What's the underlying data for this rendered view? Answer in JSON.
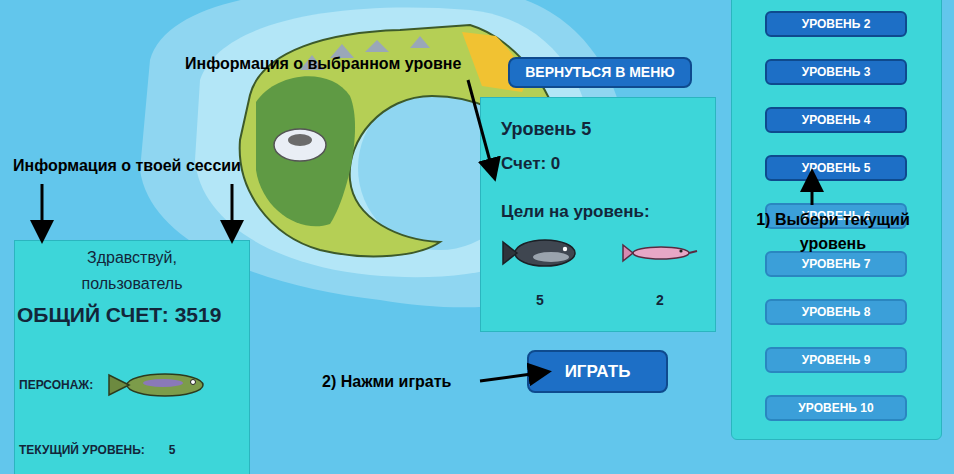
{
  "annotations": {
    "level_info": "Информация о выбранном уровне",
    "session_info": "Информация о твоей сессии",
    "choose_level": "1) Выбери текущий уровень",
    "press_play": "2) Нажми играть"
  },
  "menu_button": "ВЕРНУТЬСЯ В МЕНЮ",
  "level_panel": {
    "title": "Уровень 5",
    "score": "Счет: 0",
    "goals_label": "Цели на уровень:",
    "goals": [
      {
        "kind": "catfish",
        "count": "5"
      },
      {
        "kind": "pipefish",
        "count": "2"
      }
    ]
  },
  "play_button": "ИГРАТЬ",
  "session_panel": {
    "greeting": "Здравствуй, пользователь",
    "total_score": "ОБЩИЙ СЧЕТ: 3519",
    "character_label": "ПЕРСОНАЖ:",
    "current_level_label": "ТЕКУЩИЙ УРОВЕНЬ:",
    "current_level": "5"
  },
  "levels": [
    {
      "label": "УРОВЕНЬ 2",
      "disabled": false
    },
    {
      "label": "УРОВЕНЬ 3",
      "disabled": false
    },
    {
      "label": "УРОВЕНЬ 4",
      "disabled": false
    },
    {
      "label": "УРОВЕНЬ 5",
      "disabled": false
    },
    {
      "label": "УРОВЕНЬ 6",
      "disabled": true
    },
    {
      "label": "УРОВЕНЬ 7",
      "disabled": true
    },
    {
      "label": "УРОВЕНЬ 8",
      "disabled": true
    },
    {
      "label": "УРОВЕНЬ 9",
      "disabled": true
    },
    {
      "label": "УРОВЕНЬ 10",
      "disabled": true
    }
  ]
}
